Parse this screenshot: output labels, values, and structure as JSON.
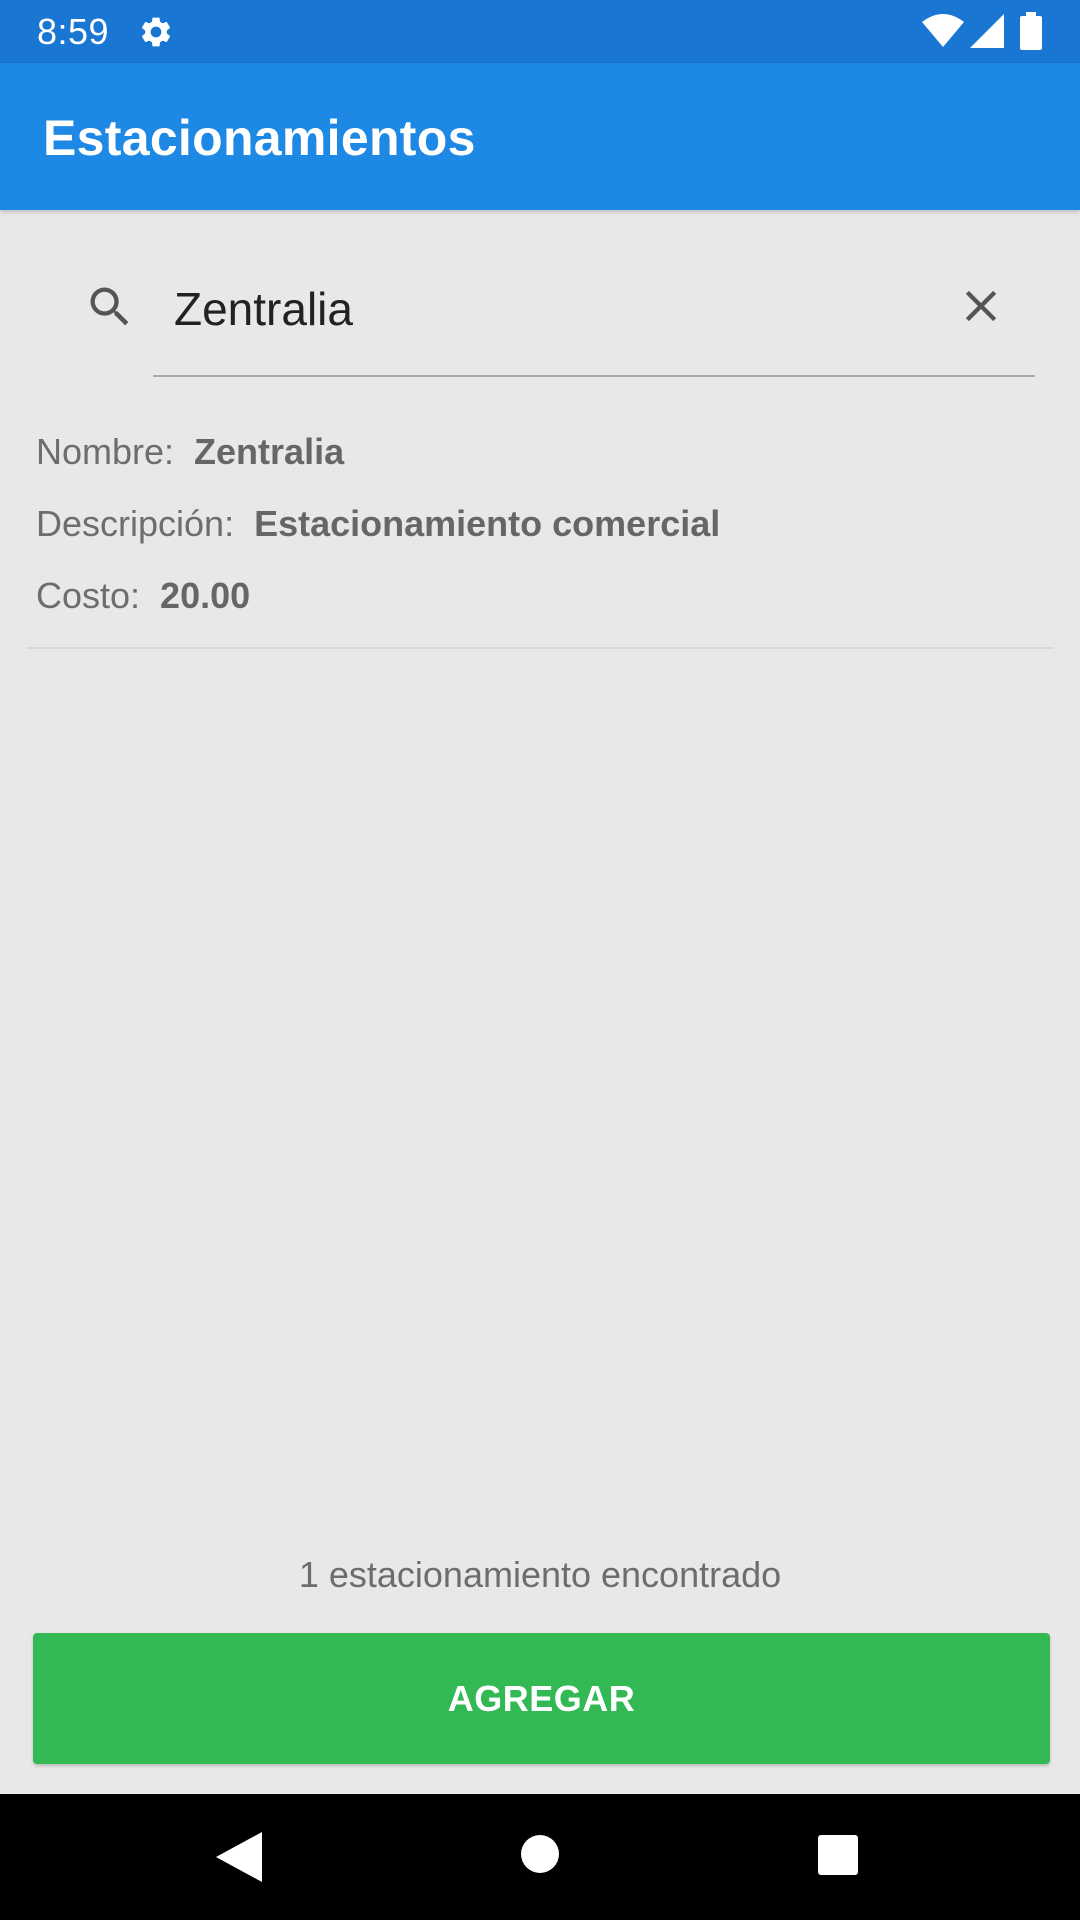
{
  "status_bar": {
    "time": "8:59",
    "icons": [
      "gear-icon",
      "wifi-icon",
      "signal-icon",
      "battery-icon"
    ]
  },
  "app_bar": {
    "title": "Estacionamientos"
  },
  "search": {
    "value": "Zentralia",
    "search_icon": "search-icon",
    "clear_icon": "close-icon"
  },
  "results": [
    {
      "name_label": "Nombre:",
      "name_value": "Zentralia",
      "description_label": "Descripción:",
      "description_value": "Estacionamiento comercial",
      "cost_label": "Costo:",
      "cost_value": "20.00"
    }
  ],
  "footer": {
    "count_text": "1 estacionamiento encontrado",
    "add_button_label": "AGREGAR"
  },
  "nav_bar": {
    "icons": [
      "back-icon",
      "home-icon",
      "recents-icon"
    ]
  },
  "colors": {
    "status_bar": "#1976d2",
    "app_bar": "#1e88e5",
    "background": "#e8e8e8",
    "add_button": "#33b954"
  }
}
